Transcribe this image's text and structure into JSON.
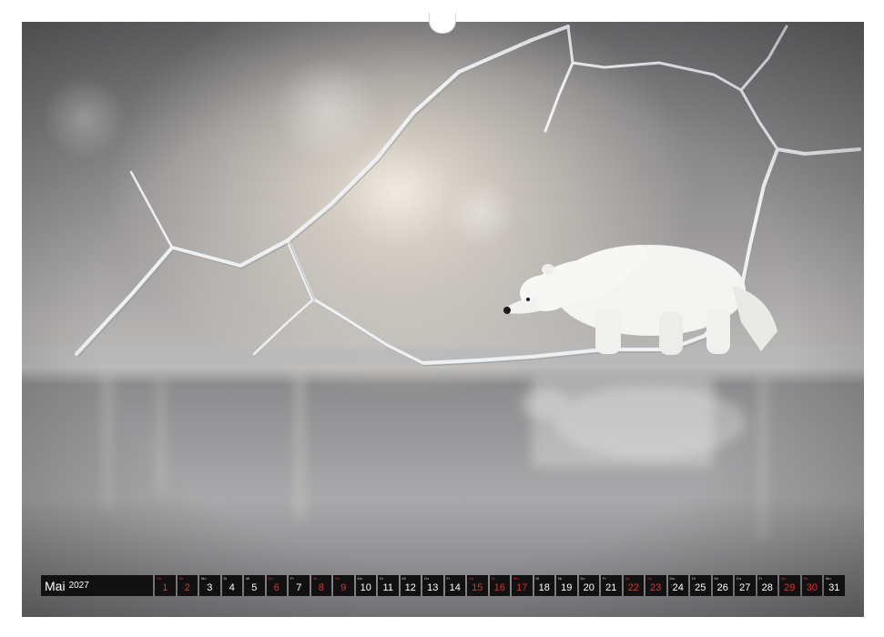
{
  "calendar": {
    "month": "Mai",
    "year": "2027",
    "days": [
      {
        "wd": "Sa",
        "num": "1",
        "holiday": true
      },
      {
        "wd": "So",
        "num": "2",
        "holiday": true
      },
      {
        "wd": "Mo",
        "num": "3",
        "holiday": false
      },
      {
        "wd": "Di",
        "num": "4",
        "holiday": false
      },
      {
        "wd": "Mi",
        "num": "5",
        "holiday": false
      },
      {
        "wd": "Do",
        "num": "6",
        "holiday": true
      },
      {
        "wd": "Fr",
        "num": "7",
        "holiday": false
      },
      {
        "wd": "Sa",
        "num": "8",
        "holiday": true
      },
      {
        "wd": "So",
        "num": "9",
        "holiday": true
      },
      {
        "wd": "Mo",
        "num": "10",
        "holiday": false
      },
      {
        "wd": "Di",
        "num": "11",
        "holiday": false
      },
      {
        "wd": "Mi",
        "num": "12",
        "holiday": false
      },
      {
        "wd": "Do",
        "num": "13",
        "holiday": false
      },
      {
        "wd": "Fr",
        "num": "14",
        "holiday": false
      },
      {
        "wd": "Sa",
        "num": "15",
        "holiday": true
      },
      {
        "wd": "So",
        "num": "16",
        "holiday": true
      },
      {
        "wd": "Mo",
        "num": "17",
        "holiday": true
      },
      {
        "wd": "Di",
        "num": "18",
        "holiday": false
      },
      {
        "wd": "Mi",
        "num": "19",
        "holiday": false
      },
      {
        "wd": "Do",
        "num": "20",
        "holiday": false
      },
      {
        "wd": "Fr",
        "num": "21",
        "holiday": false
      },
      {
        "wd": "Sa",
        "num": "22",
        "holiday": true
      },
      {
        "wd": "So",
        "num": "23",
        "holiday": true
      },
      {
        "wd": "Mo",
        "num": "24",
        "holiday": false
      },
      {
        "wd": "Di",
        "num": "25",
        "holiday": false
      },
      {
        "wd": "Mi",
        "num": "26",
        "holiday": false
      },
      {
        "wd": "Do",
        "num": "27",
        "holiday": false
      },
      {
        "wd": "Fr",
        "num": "28",
        "holiday": false
      },
      {
        "wd": "Sa",
        "num": "29",
        "holiday": true
      },
      {
        "wd": "So",
        "num": "30",
        "holiday": true
      },
      {
        "wd": "Mo",
        "num": "31",
        "holiday": false
      }
    ]
  },
  "photo": {
    "subject": "polar-bear-on-cracked-ice",
    "colors": {
      "background": "#8f8f8f",
      "ice_crack": "#e9ecef",
      "bear": "#f4f4f2",
      "holiday": "#e0312f",
      "bar": "#111111"
    }
  }
}
